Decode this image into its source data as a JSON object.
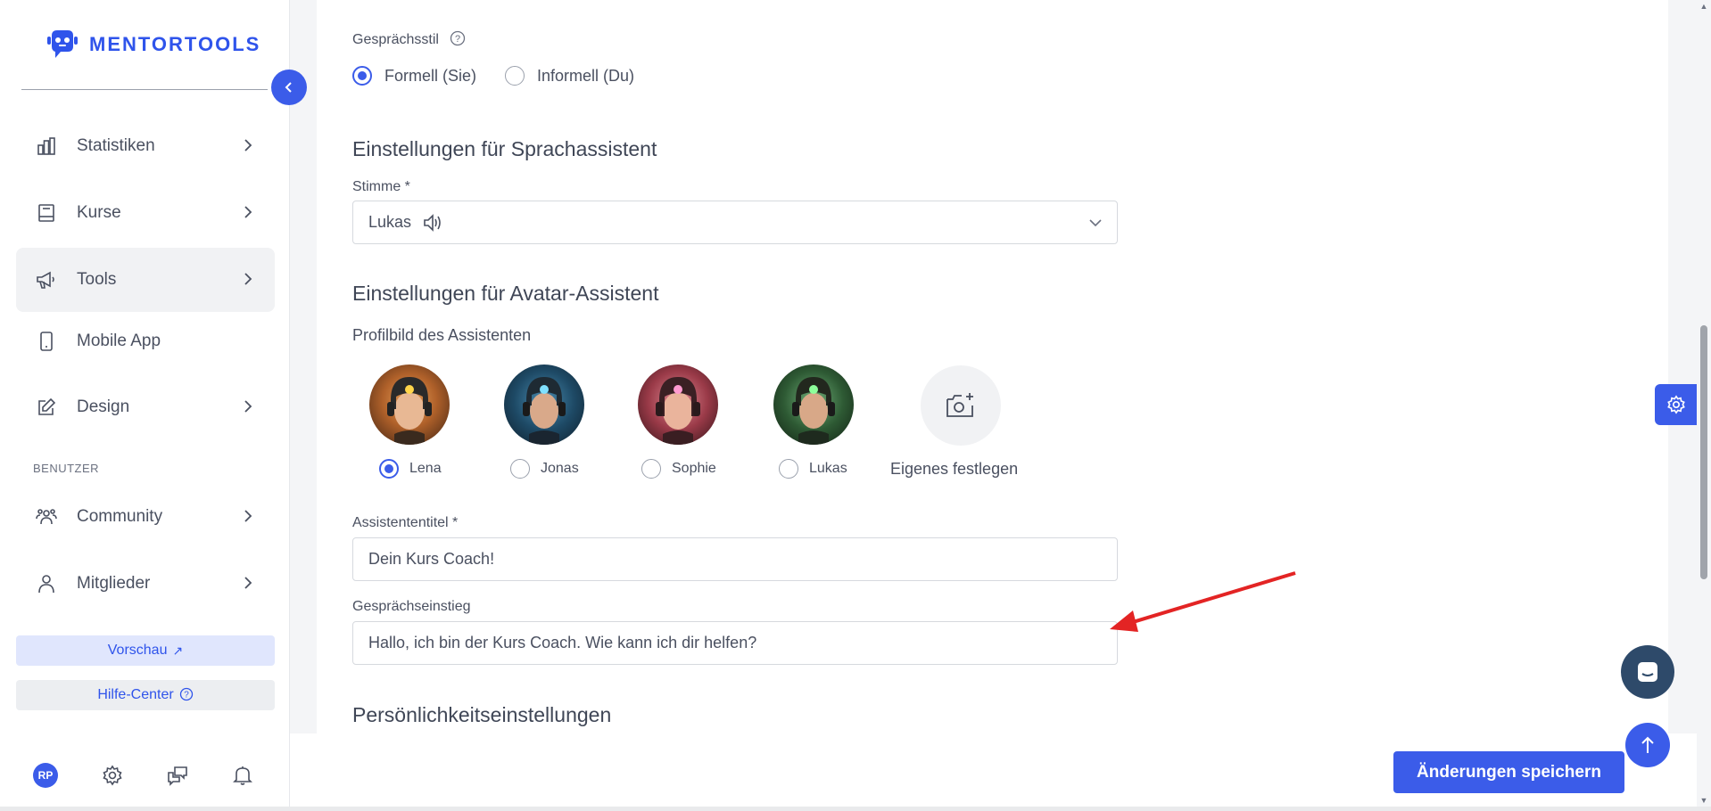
{
  "app": {
    "brand": "MENTORTOOLS",
    "brand_color": "#2f54eb",
    "accent": "#3b5ce9"
  },
  "sidebar": {
    "items": [
      {
        "label": "Statistiken",
        "icon": "bar-chart-icon"
      },
      {
        "label": "Kurse",
        "icon": "book-icon"
      },
      {
        "label": "Tools",
        "icon": "megaphone-icon",
        "active": true
      },
      {
        "label": "Mobile App",
        "icon": "smartphone-icon"
      },
      {
        "label": "Design",
        "icon": "pencil-icon"
      }
    ],
    "section_users": "BENUTZER",
    "user_items": [
      {
        "label": "Community",
        "icon": "people-icon"
      },
      {
        "label": "Mitglieder",
        "icon": "user-icon"
      }
    ],
    "preview_label": "Vorschau",
    "help_label": "Hilfe-Center",
    "avatar_initials": "RP"
  },
  "form": {
    "conversation_style": {
      "label": "Gesprächsstil",
      "options": [
        "Formell (Sie)",
        "Informell (Du)"
      ],
      "selected": "Formell (Sie)"
    },
    "voice_section": {
      "title": "Einstellungen für Sprachassistent",
      "voice_label": "Stimme *",
      "voice_value": "Lukas"
    },
    "avatar_section": {
      "title": "Einstellungen für Avatar-Assistent",
      "profile_label": "Profilbild des Assistenten",
      "avatars": [
        "Lena",
        "Jonas",
        "Sophie",
        "Lukas"
      ],
      "selected": "Lena",
      "custom_label": "Eigenes festlegen"
    },
    "assistant_title": {
      "label": "Assistententitel *",
      "value": "Dein Kurs Coach!"
    },
    "opening": {
      "label": "Gesprächseinstieg",
      "value": "Hallo, ich bin der Kurs Coach. Wie kann ich dir helfen?"
    },
    "personality_title": "Persönlichkeitseinstellungen"
  },
  "footer": {
    "save_label": "Änderungen speichern"
  }
}
